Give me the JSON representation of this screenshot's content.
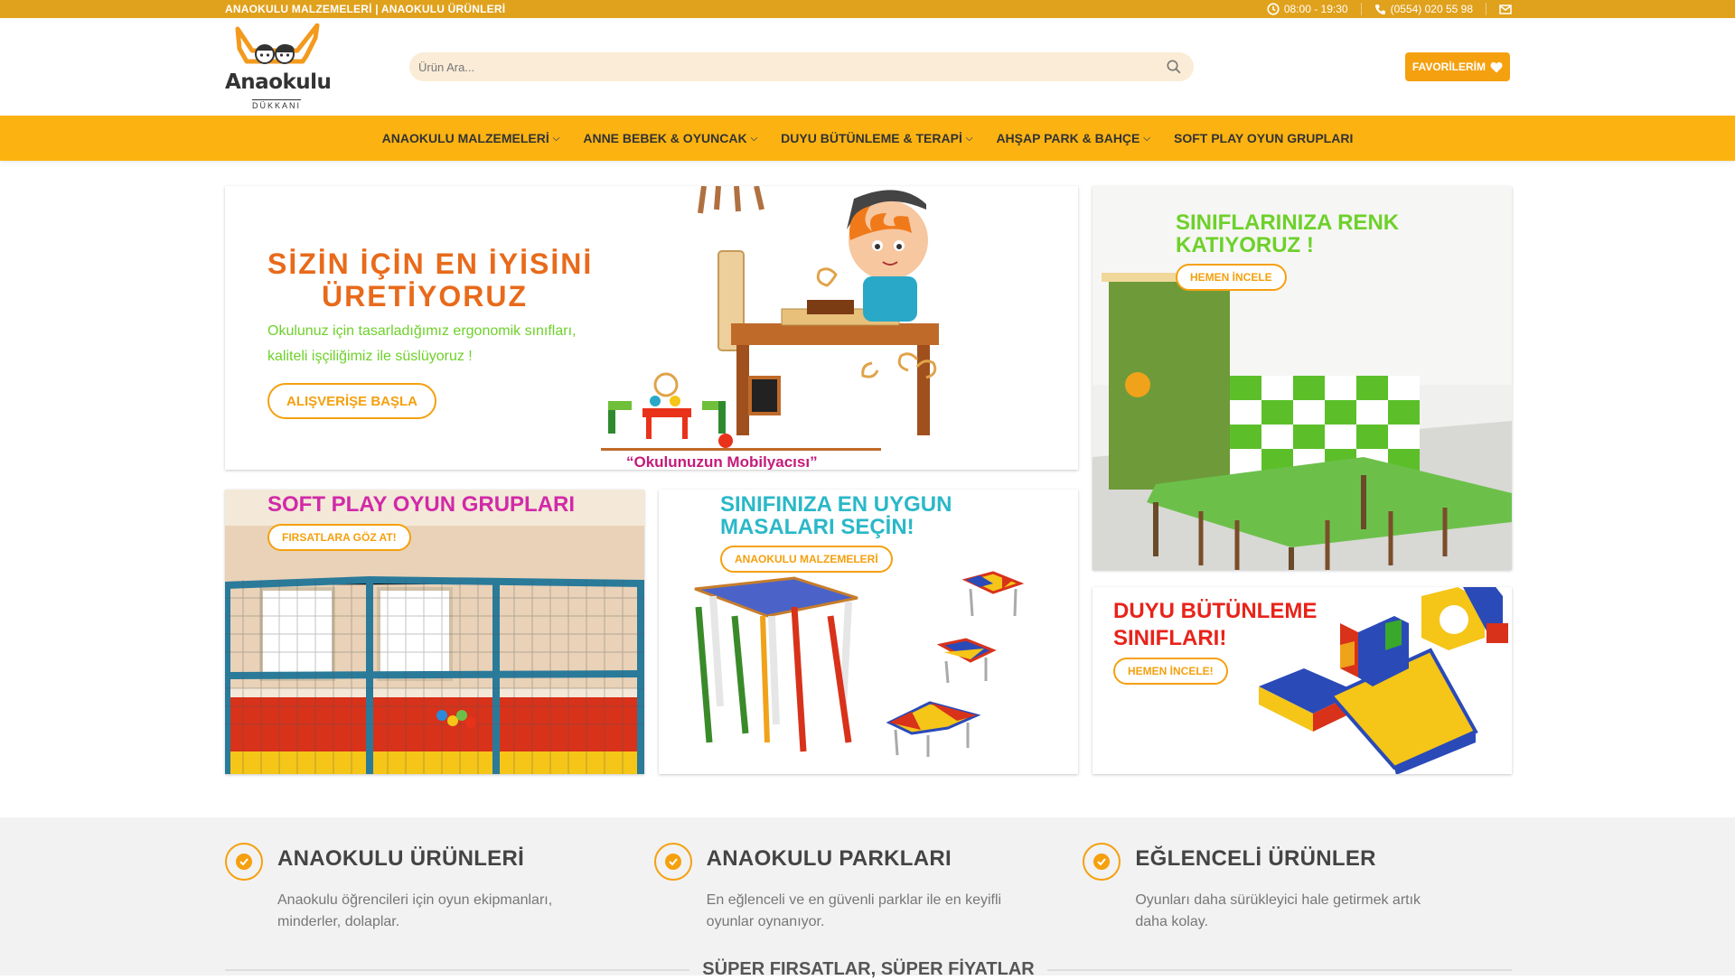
{
  "topbar": {
    "left_text": "ANAOKULU MALZEMELERİ | ANAOKULU ÜRÜNLERİ",
    "hours": "08:00 - 19:30",
    "phone": "(0554) 020 55 98"
  },
  "logo": {
    "word": "Anaokulu",
    "sub": "DÜKKANI"
  },
  "search": {
    "placeholder": "Ürün Ara..."
  },
  "favorites_label": "FAVORİLERİM",
  "nav": [
    {
      "label": "ANAOKULU MALZEMELERİ",
      "dropdown": true
    },
    {
      "label": "ANNE BEBEK & OYUNCAK",
      "dropdown": true
    },
    {
      "label": "DUYU BÜTÜNLEME & TERAPİ",
      "dropdown": true
    },
    {
      "label": "AHŞAP PARK & BAHÇE",
      "dropdown": true
    },
    {
      "label": "SOFT PLAY OYUN GRUPLARI",
      "dropdown": false
    }
  ],
  "hero": {
    "title_line1": "SİZİN İÇİN EN İYİSİNİ",
    "title_line2": "ÜRETİYORUZ",
    "text_line1": "Okulunuz için tasarladığımız ergonomik sınıfları,",
    "text_line2": "kaliteli işçiliğimiz ile süslüyoruz !",
    "button": "ALIŞVERİŞE BAŞLA",
    "caption": "“Okulunuzun Mobilyacısı”"
  },
  "classroom": {
    "title_line1": "SINIFLARINIZA RENK",
    "title_line2": "KATIYORUZ !",
    "button": "HEMEN İNCELE"
  },
  "softplay": {
    "title": "SOFT PLAY OYUN GRUPLARI",
    "button": "FIRSATLARA GÖZ AT!"
  },
  "tables": {
    "title_line1": "SINIFINIZA EN UYGUN",
    "title_line2": "MASALARI SEÇİN!",
    "button": "ANAOKULU MALZEMELERİ"
  },
  "sensory": {
    "title_line1": "DUYU BÜTÜNLEME",
    "title_line2": "SINIFLARI!",
    "button": "HEMEN İNCELE!"
  },
  "features": [
    {
      "title": "ANAOKULU ÜRÜNLERİ",
      "text": "Anaokulu öğrencileri için oyun ekipmanları, minderler, dolaplar."
    },
    {
      "title": "ANAOKULU PARKLARI",
      "text": "En eğlenceli ve en güvenli parklar ile en keyifli oyunlar oynanıyor."
    },
    {
      "title": "EĞLENCELİ ÜRÜNLER",
      "text": "Oyunları daha sürükleyici hale getirmek artık daha kolay."
    }
  ],
  "deals_heading": "SÜPER FIRSATLAR, SÜPER FİYATLAR",
  "colors": {
    "topbar": "#e0a11c",
    "nav": "#fcb312",
    "accent": "#f5a00f",
    "hero_title": "#e86a1a",
    "green": "#6dd12a",
    "magenta": "#d12aa8",
    "red": "#e8231a"
  }
}
